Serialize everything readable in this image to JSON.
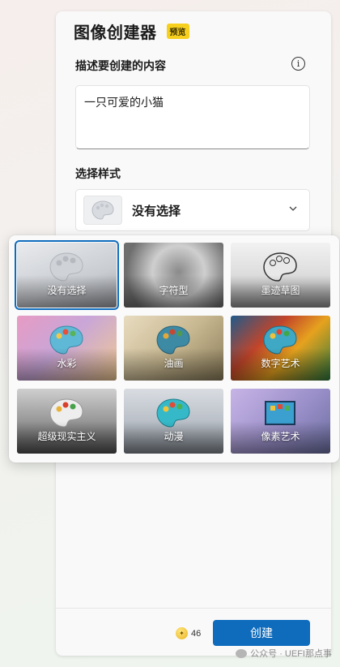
{
  "header": {
    "title": "图像创建器",
    "badge": "预览"
  },
  "description": {
    "label": "描述要创建的内容",
    "value": "一只可爱的小猫"
  },
  "style": {
    "label": "选择样式",
    "selected": "没有选择"
  },
  "styles": [
    {
      "label": "没有选择",
      "selected": true
    },
    {
      "label": "字符型",
      "selected": false
    },
    {
      "label": "墨迹草图",
      "selected": false
    },
    {
      "label": "水彩",
      "selected": false
    },
    {
      "label": "油画",
      "selected": false
    },
    {
      "label": "数字艺术",
      "selected": false
    },
    {
      "label": "超级现实主义",
      "selected": false
    },
    {
      "label": "动漫",
      "selected": false
    },
    {
      "label": "像素艺术",
      "selected": false
    }
  ],
  "footer": {
    "credits": "46",
    "create_label": "创建"
  },
  "watermark": "公众号 · UEFI那点事",
  "icons": {
    "info": "info-icon",
    "dropdown": "chevron-down-icon",
    "credits": "coin-icon",
    "palette": "palette-icon"
  },
  "colors": {
    "accent": "#0f6cbd",
    "badge": "#f7d01e"
  }
}
